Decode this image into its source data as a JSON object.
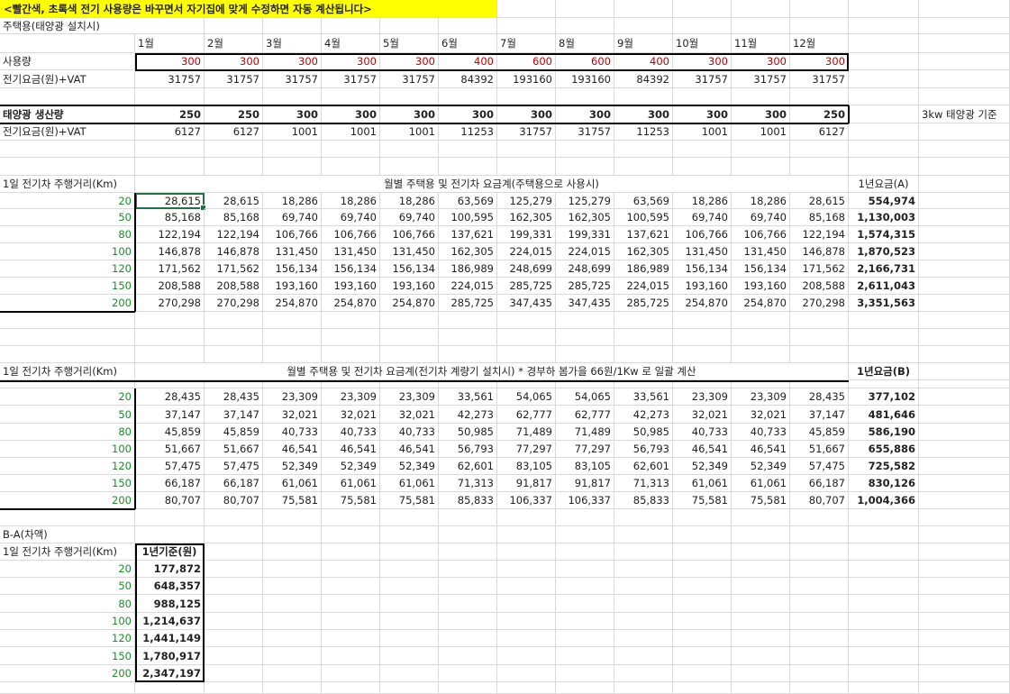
{
  "title": "<빨간색, 초록색 전기 사용량은 바꾸면서 자기집에 맞게 수정하면 자동 계산됩니다>",
  "section1": {
    "label": "주택용(태양광 설치시)",
    "months": [
      "1월",
      "2월",
      "3월",
      "4월",
      "5월",
      "6월",
      "7월",
      "8월",
      "9월",
      "10월",
      "11월",
      "12월"
    ],
    "usage_label": "사용량",
    "usage": [
      "300",
      "300",
      "300",
      "300",
      "300",
      "400",
      "600",
      "600",
      "400",
      "300",
      "300",
      "300"
    ],
    "fee_label": "전기요금(원)+VAT",
    "fee": [
      "31757",
      "31757",
      "31757",
      "31757",
      "31757",
      "84392",
      "193160",
      "193160",
      "84392",
      "31757",
      "31757",
      "31757"
    ]
  },
  "section2": {
    "solar_label": "태양광 생산량",
    "solar": [
      "250",
      "250",
      "300",
      "300",
      "300",
      "300",
      "300",
      "300",
      "300",
      "300",
      "300",
      "250"
    ],
    "fee_label": "전기요금(원)+VAT",
    "fee": [
      "6127",
      "6127",
      "1001",
      "1001",
      "1001",
      "11253",
      "31757",
      "31757",
      "11253",
      "1001",
      "1001",
      "6127"
    ],
    "note": "3kw 태양광 기준"
  },
  "tableA": {
    "distance_label": "1일 전기차 주행거리(Km)",
    "heading": "월별 주택용 및 전기차 요금계(주택용으로 사용시)",
    "total_label": "1년요금(A)",
    "rows": [
      {
        "km": "20",
        "values": [
          "28,615",
          "28,615",
          "18,286",
          "18,286",
          "18,286",
          "63,569",
          "125,279",
          "125,279",
          "63,569",
          "18,286",
          "18,286",
          "28,615"
        ],
        "total": "554,974"
      },
      {
        "km": "50",
        "values": [
          "85,168",
          "85,168",
          "69,740",
          "69,740",
          "69,740",
          "100,595",
          "162,305",
          "162,305",
          "100,595",
          "69,740",
          "69,740",
          "85,168"
        ],
        "total": "1,130,003"
      },
      {
        "km": "80",
        "values": [
          "122,194",
          "122,194",
          "106,766",
          "106,766",
          "106,766",
          "137,621",
          "199,331",
          "199,331",
          "137,621",
          "106,766",
          "106,766",
          "122,194"
        ],
        "total": "1,574,315"
      },
      {
        "km": "100",
        "values": [
          "146,878",
          "146,878",
          "131,450",
          "131,450",
          "131,450",
          "162,305",
          "224,015",
          "224,015",
          "162,305",
          "131,450",
          "131,450",
          "146,878"
        ],
        "total": "1,870,523"
      },
      {
        "km": "120",
        "values": [
          "171,562",
          "171,562",
          "156,134",
          "156,134",
          "156,134",
          "186,989",
          "248,699",
          "248,699",
          "186,989",
          "156,134",
          "156,134",
          "171,562"
        ],
        "total": "2,166,731"
      },
      {
        "km": "150",
        "values": [
          "208,588",
          "208,588",
          "193,160",
          "193,160",
          "193,160",
          "224,015",
          "285,725",
          "285,725",
          "224,015",
          "193,160",
          "193,160",
          "208,588"
        ],
        "total": "2,611,043"
      },
      {
        "km": "200",
        "values": [
          "270,298",
          "270,298",
          "254,870",
          "254,870",
          "254,870",
          "285,725",
          "347,435",
          "347,435",
          "285,725",
          "254,870",
          "254,870",
          "270,298"
        ],
        "total": "3,351,563"
      }
    ]
  },
  "tableB": {
    "distance_label": "1일 전기차 주행거리(Km)",
    "heading": "월별 주택용 및 전기차 요금계(전기차 계량기 설치시) * 경부하 봄가을 66원/1Kw 로 일괄 계산",
    "total_label": "1년요금(B)",
    "rows": [
      {
        "km": "20",
        "values": [
          "28,435",
          "28,435",
          "23,309",
          "23,309",
          "23,309",
          "33,561",
          "54,065",
          "54,065",
          "33,561",
          "23,309",
          "23,309",
          "28,435"
        ],
        "total": "377,102"
      },
      {
        "km": "50",
        "values": [
          "37,147",
          "37,147",
          "32,021",
          "32,021",
          "32,021",
          "42,273",
          "62,777",
          "62,777",
          "42,273",
          "32,021",
          "32,021",
          "37,147"
        ],
        "total": "481,646"
      },
      {
        "km": "80",
        "values": [
          "45,859",
          "45,859",
          "40,733",
          "40,733",
          "40,733",
          "50,985",
          "71,489",
          "71,489",
          "50,985",
          "40,733",
          "40,733",
          "45,859"
        ],
        "total": "586,190"
      },
      {
        "km": "100",
        "values": [
          "51,667",
          "51,667",
          "46,541",
          "46,541",
          "46,541",
          "56,793",
          "77,297",
          "77,297",
          "56,793",
          "46,541",
          "46,541",
          "51,667"
        ],
        "total": "655,886"
      },
      {
        "km": "120",
        "values": [
          "57,475",
          "57,475",
          "52,349",
          "52,349",
          "52,349",
          "62,601",
          "83,105",
          "83,105",
          "62,601",
          "52,349",
          "52,349",
          "57,475"
        ],
        "total": "725,582"
      },
      {
        "km": "150",
        "values": [
          "66,187",
          "66,187",
          "61,061",
          "61,061",
          "61,061",
          "71,313",
          "91,817",
          "91,817",
          "71,313",
          "61,061",
          "61,061",
          "66,187"
        ],
        "total": "830,126"
      },
      {
        "km": "200",
        "values": [
          "80,707",
          "80,707",
          "75,581",
          "75,581",
          "75,581",
          "85,833",
          "106,337",
          "106,337",
          "85,833",
          "75,581",
          "75,581",
          "80,707"
        ],
        "total": "1,004,366"
      }
    ]
  },
  "diff": {
    "label": "B-A(차액)",
    "distance_label": "1일 전기차 주행거리(Km)",
    "header": "1년기준(원)",
    "rows": [
      {
        "km": "20",
        "value": "177,872"
      },
      {
        "km": "50",
        "value": "648,357"
      },
      {
        "km": "80",
        "value": "988,125"
      },
      {
        "km": "100",
        "value": "1,214,637"
      },
      {
        "km": "120",
        "value": "1,441,149"
      },
      {
        "km": "150",
        "value": "1,780,917"
      },
      {
        "km": "200",
        "value": "2,347,197"
      }
    ]
  }
}
